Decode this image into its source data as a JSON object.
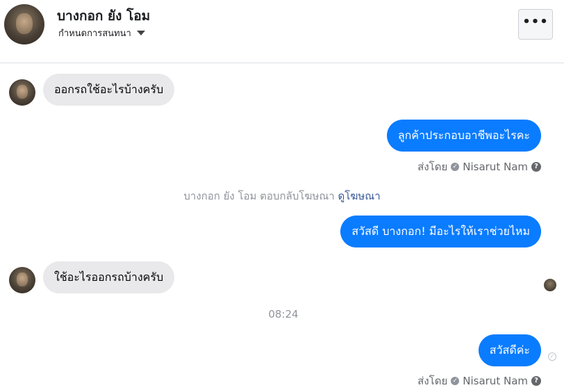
{
  "header": {
    "contact_name": "บางกอก ยัง โอม",
    "settings_label": "กำหนดการสนทนา",
    "more_label": "•••"
  },
  "messages": [
    {
      "direction": "incoming",
      "text": "ออกรถใช้อะไรบ้างครับ"
    },
    {
      "direction": "outgoing",
      "text": "ลูกค้าประกอบอาชีพอะไรคะ",
      "sent_by_label": "ส่งโดย",
      "sender": "Nisarut Nam"
    },
    {
      "direction": "outgoing",
      "text": "สวัสดี บางกอก! มีอะไรให้เราช่วยไหม"
    },
    {
      "direction": "incoming",
      "text": "ใช้อะไรออกรถบ้างครับ"
    },
    {
      "direction": "outgoing",
      "text": "สวัสดีค่ะ",
      "sent_by_label": "ส่งโดย",
      "sender": "Nisarut Nam"
    }
  ],
  "system_note": {
    "text": "บางกอก ยัง โอม ตอบกลับโฆษณา",
    "link": "ดูโฆษณา"
  },
  "timestamp": "08:24",
  "icons": {
    "help": "?",
    "check": "✓"
  },
  "colors": {
    "outgoing_bubble": "#0a7cff",
    "incoming_bubble": "#e9e9eb",
    "link": "#385898"
  }
}
